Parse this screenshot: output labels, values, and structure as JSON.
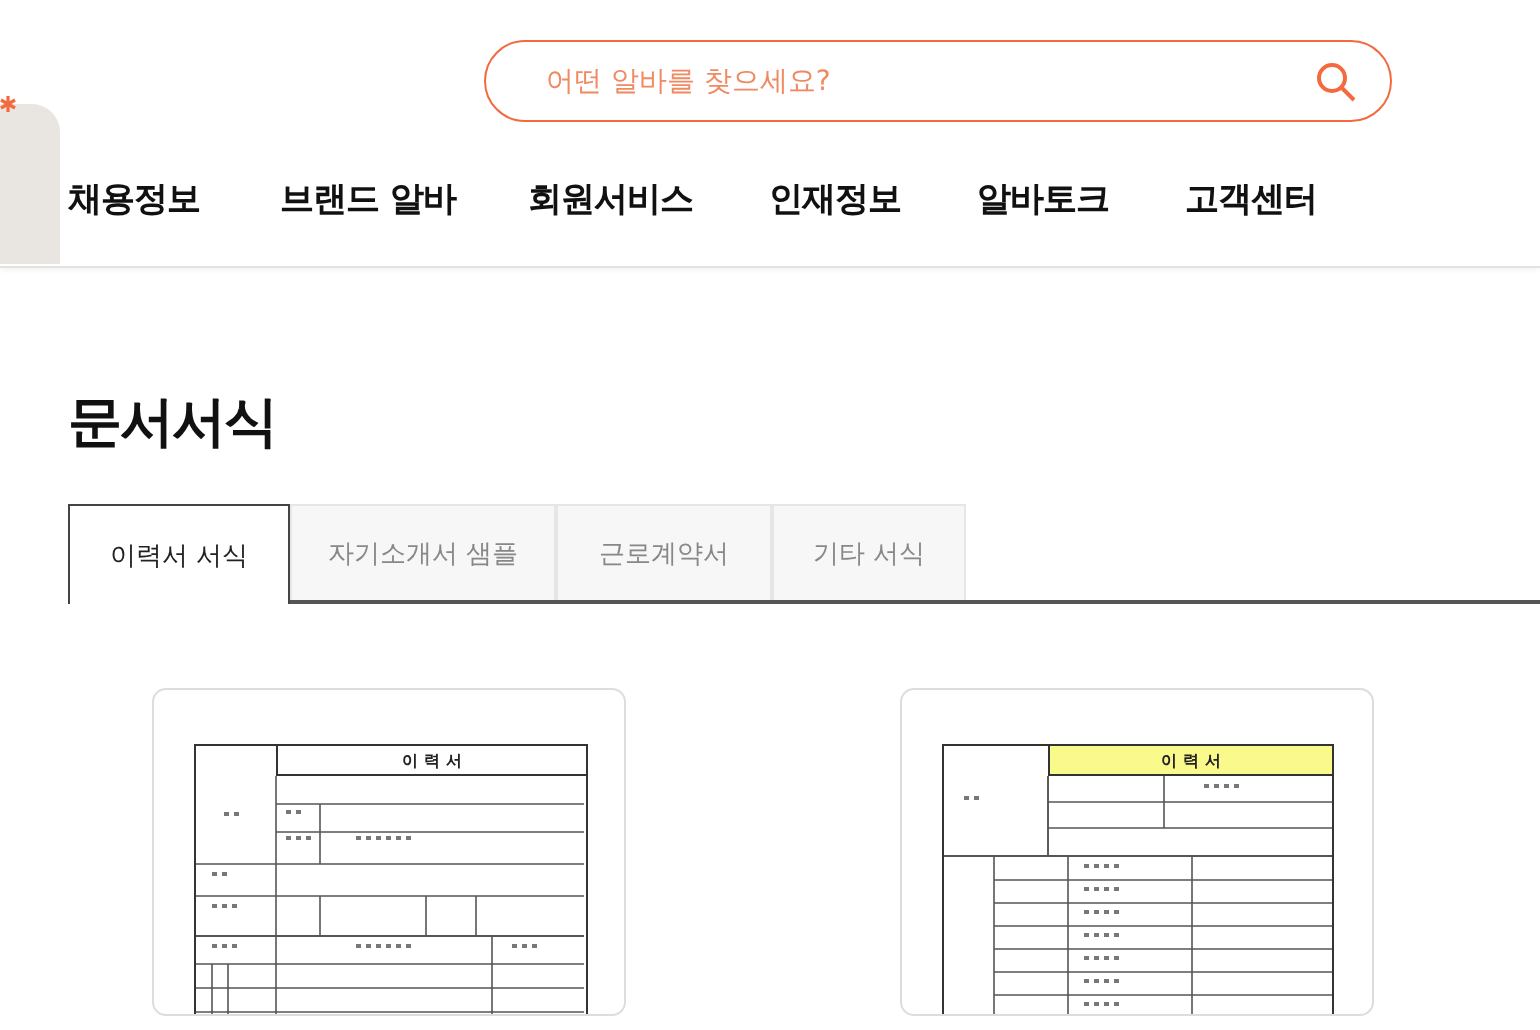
{
  "search": {
    "placeholder": "어떤 알바를 찾으세요?"
  },
  "nav": [
    {
      "label": "채용정보"
    },
    {
      "label": "브랜드 알바"
    },
    {
      "label": "회원서비스"
    },
    {
      "label": "인재정보"
    },
    {
      "label": "알바토크"
    },
    {
      "label": "고객센터"
    }
  ],
  "page_title": "문서서식",
  "tabs": [
    {
      "label": "이력서 서식",
      "selected": true
    },
    {
      "label": "자기소개서 샘플",
      "selected": false
    },
    {
      "label": "근로계약서",
      "selected": false
    },
    {
      "label": "기타 서식",
      "selected": false
    }
  ],
  "cards": [
    {
      "title": "이 력 서",
      "kind": "plain"
    },
    {
      "title": "이 력 서",
      "kind": "highlighted"
    }
  ]
}
